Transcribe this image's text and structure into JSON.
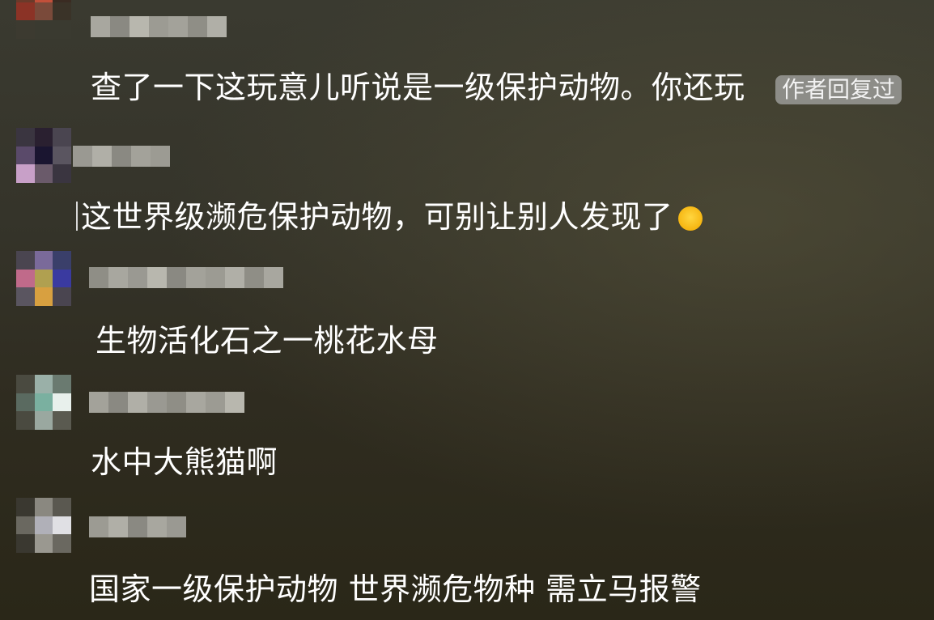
{
  "comments": [
    {
      "text": "查了一下这玩意儿听说是一级保护动物。你还玩",
      "badge": "作者回复过",
      "avatar_colors": [
        "#6a3a2a",
        "#c2503a",
        "#3a2b22",
        "#8b3326",
        "#7a4a3a",
        "#3a3328",
        "#3c3a30",
        "#3a3a30",
        "#3a3a30"
      ],
      "username_colors": [
        "#a8a79f",
        "#8a8982",
        "#b8b7ae",
        "#9c9b93",
        "#a3a29a",
        "#8f8e86",
        "#b0afa7"
      ]
    },
    {
      "text": "这世界级濒危保护动物，可别让别人发现了",
      "emoji": "😂",
      "avatar_colors": [
        "#3a3540",
        "#2a2030",
        "#4a4550",
        "#5a4a6a",
        "#1a1530",
        "#5a5560",
        "#c8a0c8",
        "#6a5a6a",
        "#3a3540"
      ],
      "username_colors": [
        "#9a9992",
        "#b0afa7",
        "#8a8982",
        "#a3a29a",
        "#9c9b93"
      ]
    },
    {
      "text": "生物活化石之一桃花水母",
      "avatar_colors": [
        "#4a4550",
        "#7a6a9a",
        "#3a3f6a",
        "#c06a8a",
        "#b0a050",
        "#3a3aa0",
        "#5a5560",
        "#d8a040",
        "#4a4550"
      ],
      "username_colors": [
        "#8f8e86",
        "#a8a79f",
        "#9a9992",
        "#b8b7ae",
        "#8a8982",
        "#a3a29a",
        "#9c9b93",
        "#b0afa7",
        "#8f8e86",
        "#a8a79f"
      ]
    },
    {
      "text": "水中大熊猫啊",
      "avatar_colors": [
        "#4a4a40",
        "#9ab0a8",
        "#6a7a70",
        "#5a6a60",
        "#7ab0a0",
        "#e8f0ec",
        "#4a4a40",
        "#9aa8a0",
        "#5a5a50"
      ],
      "username_colors": [
        "#a3a29a",
        "#8a8982",
        "#b0afa7",
        "#9a9992",
        "#8f8e86",
        "#a8a79f",
        "#9c9b93",
        "#b8b7ae"
      ]
    },
    {
      "text": "国家一级保护动物 世界濒危物种 需立马报警",
      "avatar_colors": [
        "#3a3830",
        "#8a8880",
        "#5a5850",
        "#6a6860",
        "#b0b0b8",
        "#e0e0e4",
        "#3a3830",
        "#9a9890",
        "#6a6860"
      ],
      "username_colors": [
        "#9c9b93",
        "#b0afa7",
        "#8a8982",
        "#a8a79f",
        "#9a9992"
      ]
    }
  ]
}
